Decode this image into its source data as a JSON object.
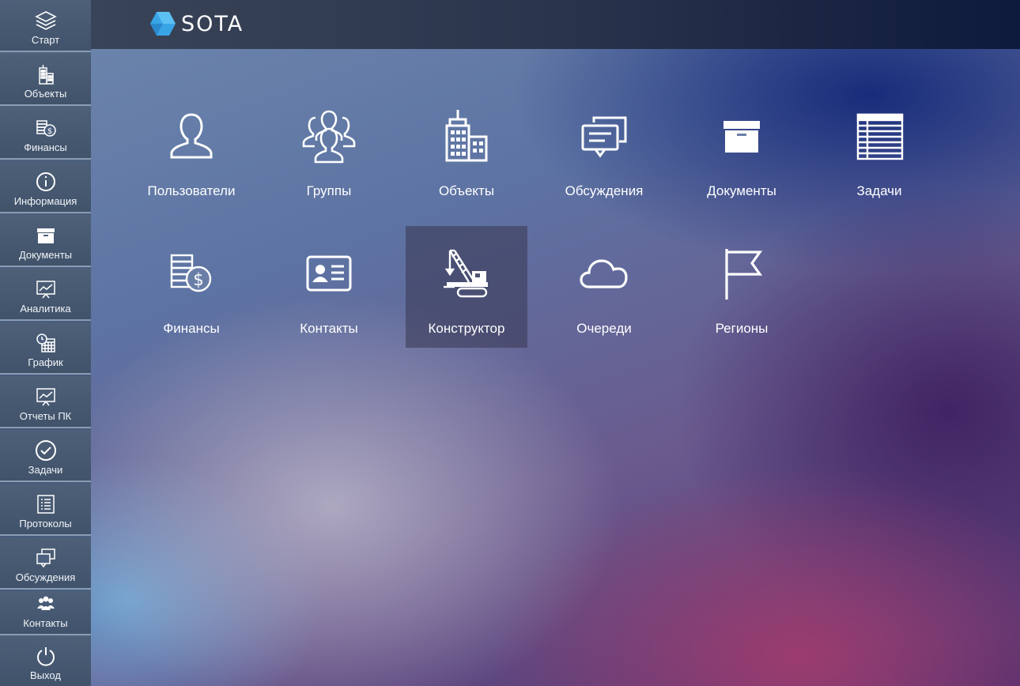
{
  "app": {
    "brand": "SOTA",
    "brand_color": "#3aa5e6"
  },
  "sidebar": {
    "items": [
      {
        "label": "Старт",
        "icon": "layers-icon"
      },
      {
        "label": "Объекты",
        "icon": "buildings-icon"
      },
      {
        "label": "Финансы",
        "icon": "finance-icon"
      },
      {
        "label": "Информация",
        "icon": "info-icon"
      },
      {
        "label": "Документы",
        "icon": "archive-box-icon"
      },
      {
        "label": "Аналитика",
        "icon": "presentation-chart-icon"
      },
      {
        "label": "График",
        "icon": "clock-calendar-icon"
      },
      {
        "label": "Отчеты ПК",
        "icon": "presentation-chart-icon"
      },
      {
        "label": "Задачи",
        "icon": "check-circle-icon"
      },
      {
        "label": "Протоколы",
        "icon": "checklist-document-icon"
      },
      {
        "label": "Обсуждения",
        "icon": "chat-windows-icon"
      },
      {
        "label": "Контакты",
        "icon": "people-group-icon"
      },
      {
        "label": "Выход",
        "icon": "power-icon"
      }
    ]
  },
  "tiles": [
    {
      "label": "Пользователи",
      "icon": "user-icon"
    },
    {
      "label": "Группы",
      "icon": "users-group-icon"
    },
    {
      "label": "Объекты",
      "icon": "buildings-icon"
    },
    {
      "label": "Обсуждения",
      "icon": "chat-bubbles-icon"
    },
    {
      "label": "Документы",
      "icon": "archive-box-icon"
    },
    {
      "label": "Задачи",
      "icon": "table-icon"
    },
    {
      "label": "Финансы",
      "icon": "finance-icon"
    },
    {
      "label": "Контакты",
      "icon": "contact-card-icon"
    },
    {
      "label": "Конструктор",
      "icon": "crane-icon",
      "active": true
    },
    {
      "label": "Очереди",
      "icon": "cloud-icon"
    },
    {
      "label": "Регионы",
      "icon": "flag-icon"
    }
  ]
}
